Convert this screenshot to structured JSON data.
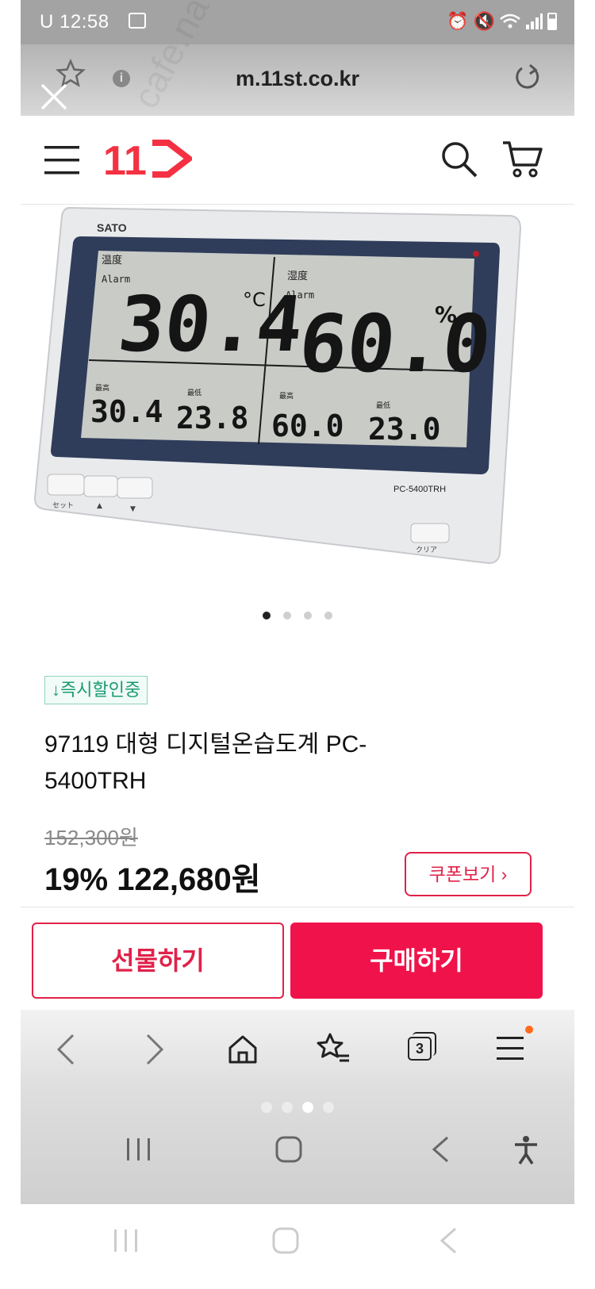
{
  "status_bar": {
    "time": "U 12:58"
  },
  "browser": {
    "url": "m.11st.co.kr",
    "tab_count": "3"
  },
  "site": {
    "logo_text": "11"
  },
  "product": {
    "device": {
      "brand": "SATO",
      "model": "PC-5400TRH",
      "temp_label": "温度",
      "humid_label": "湿度",
      "alarm": "Alarm",
      "temp_value": "30.4",
      "temp_unit": "°C",
      "humid_value": "60.0",
      "humid_unit": "%",
      "max_label": "最高",
      "min_label": "最低",
      "temp_max": "30.4",
      "temp_min": "23.8",
      "humid_max": "60.0",
      "humid_min": "23.0",
      "btn_set": "セット",
      "btn_up": "▲",
      "btn_down": "▼",
      "btn_clear": "クリア"
    },
    "badge": "↓즉시할인중",
    "title": "97119 대형 디지털온습도계 PC-5400TRH",
    "original_price": "152,300원",
    "discount": "19%",
    "sale_price": "122,680원",
    "coupon_label": "쿠폰보기 ›"
  },
  "cta": {
    "gift_label": "선물하기",
    "buy_label": "구매하기"
  },
  "watermark": "cafe.naver.com/joonggonara",
  "colors": {
    "brand_red": "#f0124a",
    "badge_green": "#1a9a72"
  }
}
